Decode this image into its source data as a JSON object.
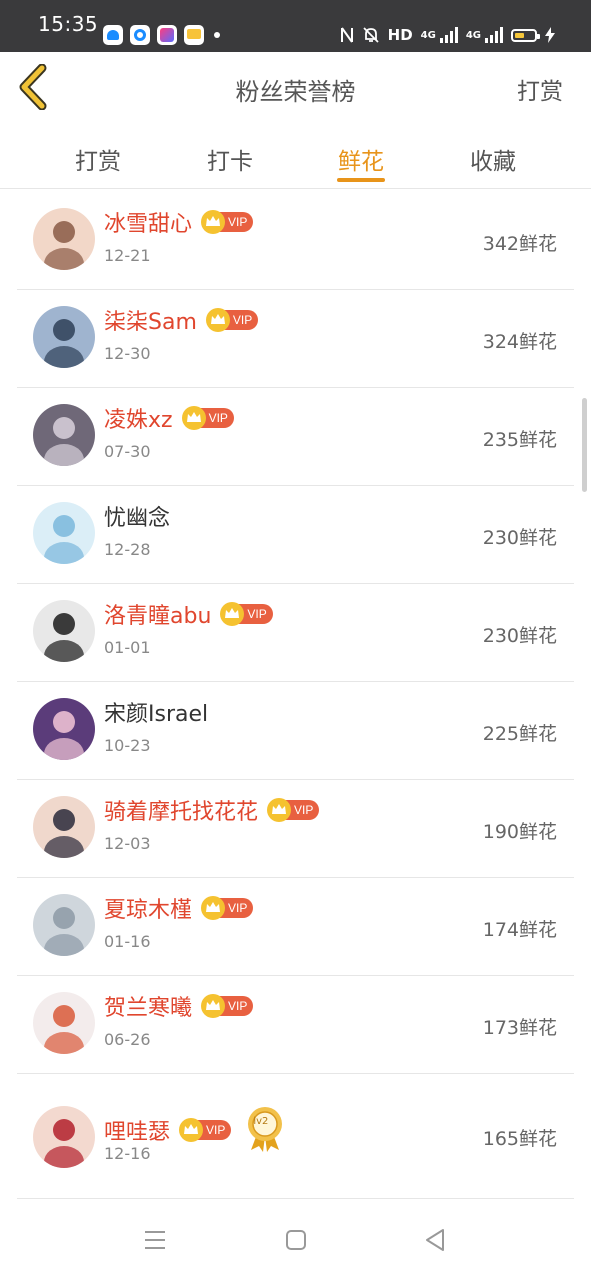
{
  "status_bar": {
    "time": "15:35",
    "network_label": "HD",
    "signal1": "4G",
    "signal2": "4G"
  },
  "header": {
    "title": "粉丝荣誉榜",
    "action": "打赏"
  },
  "tabs": [
    {
      "label": "打赏"
    },
    {
      "label": "打卡"
    },
    {
      "label": "鲜花"
    },
    {
      "label": "收藏"
    }
  ],
  "active_tab": 2,
  "fans": [
    {
      "name": "冰雪甜心",
      "date": "12-21",
      "flowers": "342鲜花",
      "vip": true,
      "vip_text": "VIP"
    },
    {
      "name": "柒柒Sam",
      "date": "12-30",
      "flowers": "324鲜花",
      "vip": true,
      "vip_text": "VIP"
    },
    {
      "name": "凌姝xz",
      "date": "07-30",
      "flowers": "235鲜花",
      "vip": true,
      "vip_text": "VIP"
    },
    {
      "name": "忧幽念",
      "date": "12-28",
      "flowers": "230鲜花",
      "vip": false
    },
    {
      "name": "洛青瞳abu",
      "date": "01-01",
      "flowers": "230鲜花",
      "vip": true,
      "vip_text": "VIP"
    },
    {
      "name": "宋颜Israel",
      "date": "10-23",
      "flowers": "225鲜花",
      "vip": false
    },
    {
      "name": "骑着摩托找花花",
      "date": "12-03",
      "flowers": "190鲜花",
      "vip": true,
      "vip_text": "VIP"
    },
    {
      "name": "夏琼木槿",
      "date": "01-16",
      "flowers": "174鲜花",
      "vip": true,
      "vip_text": "VIP"
    },
    {
      "name": "贺兰寒曦",
      "date": "06-26",
      "flowers": "173鲜花",
      "vip": true,
      "vip_text": "VIP"
    },
    {
      "name": "哩哇瑟",
      "date": "12-16",
      "flowers": "165鲜花",
      "vip": true,
      "vip_text": "VIP",
      "medal": "lv2"
    }
  ],
  "colors": {
    "accent": "#e8941a",
    "vip_name": "#e0462e",
    "vip_badge": "#e86040"
  }
}
